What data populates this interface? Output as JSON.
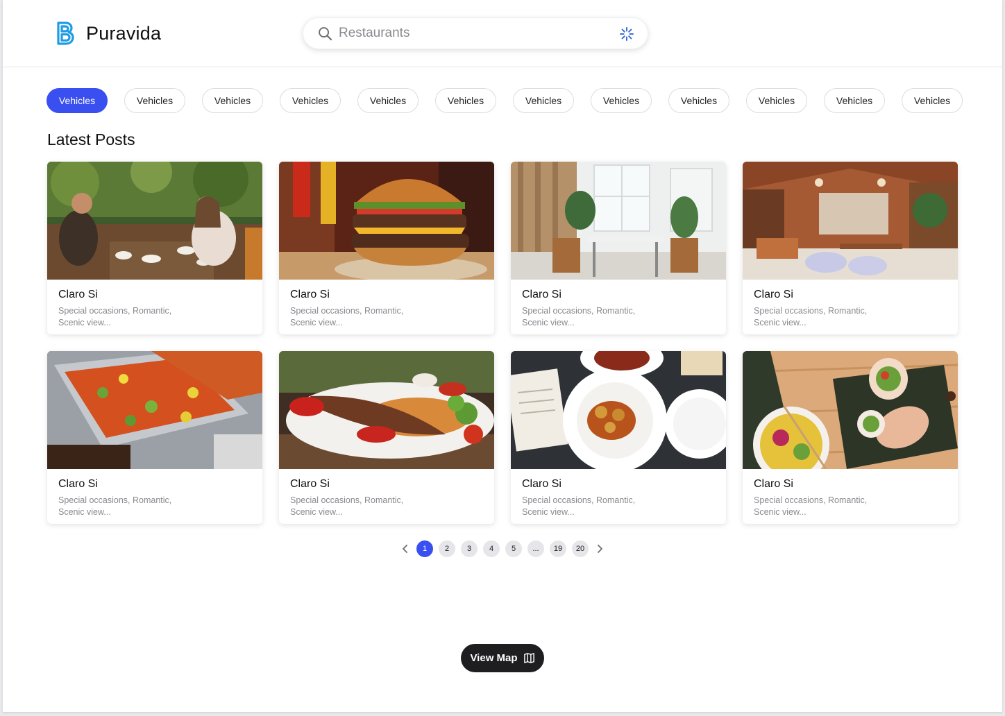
{
  "header": {
    "brand": "Puravida",
    "search": {
      "placeholder": "Restaurants",
      "value": ""
    }
  },
  "chips": [
    {
      "label": "Vehicles",
      "active": true
    },
    {
      "label": "Vehicles",
      "active": false
    },
    {
      "label": "Vehicles",
      "active": false
    },
    {
      "label": "Vehicles",
      "active": false
    },
    {
      "label": "Vehicles",
      "active": false
    },
    {
      "label": "Vehicles",
      "active": false
    },
    {
      "label": "Vehicles",
      "active": false
    },
    {
      "label": "Vehicles",
      "active": false
    },
    {
      "label": "Vehicles",
      "active": false
    },
    {
      "label": "Vehicles",
      "active": false
    },
    {
      "label": "Vehicles",
      "active": false
    },
    {
      "label": "Vehicles",
      "active": false
    }
  ],
  "section_title": "Latest Posts",
  "cards": [
    {
      "title": "Claro Si",
      "desc": "Special occasions, Romantic, Scenic view...",
      "image": "people-dining-outdoors-photo"
    },
    {
      "title": "Claro Si",
      "desc": "Special occasions, Romantic, Scenic view...",
      "image": "cheeseburger-photo"
    },
    {
      "title": "Claro Si",
      "desc": "Special occasions, Romantic, Scenic view...",
      "image": "bright-cafe-interior-photo"
    },
    {
      "title": "Claro Si",
      "desc": "Special occasions, Romantic, Scenic view...",
      "image": "wooden-restaurant-interior-photo"
    },
    {
      "title": "Claro Si",
      "desc": "Special occasions, Romantic, Scenic view...",
      "image": "buffet-trays-photo"
    },
    {
      "title": "Claro Si",
      "desc": "Special occasions, Romantic, Scenic view...",
      "image": "kebab-plate-photo"
    },
    {
      "title": "Claro Si",
      "desc": "Special occasions, Romantic, Scenic view...",
      "image": "table-of-dishes-photo"
    },
    {
      "title": "Claro Si",
      "desc": "Special occasions, Romantic, Scenic view...",
      "image": "sushi-burrito-photo"
    }
  ],
  "pagination": {
    "current": "1",
    "pages": [
      "1",
      "2",
      "3",
      "4",
      "5",
      "...",
      "19",
      "20"
    ]
  },
  "view_map_label": "View Map",
  "colors": {
    "accent": "#3a4ff0",
    "logo": "#1f9be6",
    "dark_button": "#1e1e20",
    "muted_text": "#8a8a90"
  }
}
